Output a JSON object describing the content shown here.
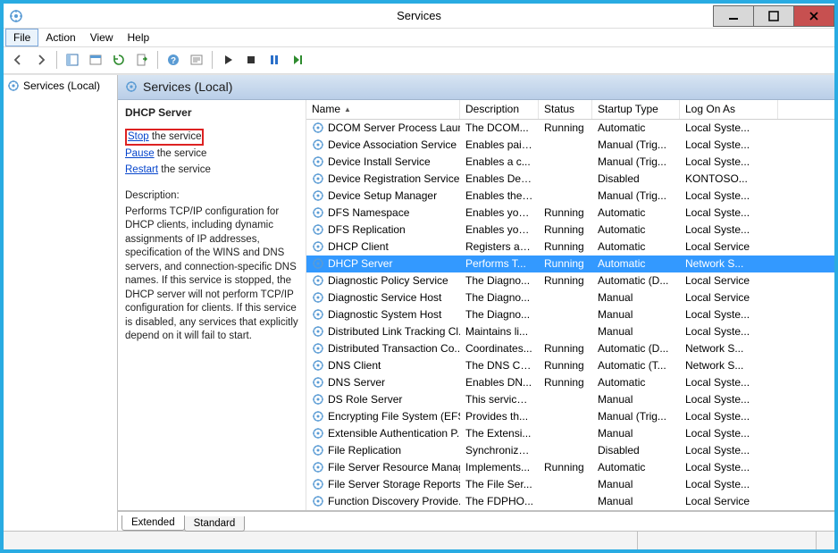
{
  "window": {
    "title": "Services",
    "menus": [
      "File",
      "Action",
      "View",
      "Help"
    ]
  },
  "tree": {
    "root": "Services (Local)"
  },
  "header": {
    "title": "Services (Local)"
  },
  "detail": {
    "service_name": "DHCP Server",
    "links": {
      "stop": "Stop",
      "stop_suffix": " the service",
      "pause": "Pause",
      "pause_suffix": " the service",
      "restart": "Restart",
      "restart_suffix": " the service"
    },
    "desc_heading": "Description:",
    "description": "Performs TCP/IP configuration for DHCP clients, including dynamic assignments of IP addresses, specification of the WINS and DNS servers, and connection-specific DNS names. If this service is stopped, the DHCP server will not perform TCP/IP configuration for clients. If this service is disabled, any services that explicitly depend on it will fail to start."
  },
  "columns": {
    "name": "Name",
    "description": "Description",
    "status": "Status",
    "startup": "Startup Type",
    "logon": "Log On As"
  },
  "tabs": {
    "extended": "Extended",
    "standard": "Standard"
  },
  "services": [
    {
      "name": "DCOM Server Process Laun...",
      "desc": "The DCOM...",
      "status": "Running",
      "start": "Automatic",
      "log": "Local Syste..."
    },
    {
      "name": "Device Association Service",
      "desc": "Enables pair...",
      "status": "",
      "start": "Manual (Trig...",
      "log": "Local Syste..."
    },
    {
      "name": "Device Install Service",
      "desc": "Enables a c...",
      "status": "",
      "start": "Manual (Trig...",
      "log": "Local Syste..."
    },
    {
      "name": "Device Registration Service",
      "desc": "Enables Dev...",
      "status": "",
      "start": "Disabled",
      "log": "KONTOSO..."
    },
    {
      "name": "Device Setup Manager",
      "desc": "Enables the ...",
      "status": "",
      "start": "Manual (Trig...",
      "log": "Local Syste..."
    },
    {
      "name": "DFS Namespace",
      "desc": "Enables you...",
      "status": "Running",
      "start": "Automatic",
      "log": "Local Syste..."
    },
    {
      "name": "DFS Replication",
      "desc": "Enables you...",
      "status": "Running",
      "start": "Automatic",
      "log": "Local Syste..."
    },
    {
      "name": "DHCP Client",
      "desc": "Registers an...",
      "status": "Running",
      "start": "Automatic",
      "log": "Local Service"
    },
    {
      "name": "DHCP Server",
      "desc": "Performs T...",
      "status": "Running",
      "start": "Automatic",
      "log": "Network S...",
      "selected": true
    },
    {
      "name": "Diagnostic Policy Service",
      "desc": "The Diagno...",
      "status": "Running",
      "start": "Automatic (D...",
      "log": "Local Service"
    },
    {
      "name": "Diagnostic Service Host",
      "desc": "The Diagno...",
      "status": "",
      "start": "Manual",
      "log": "Local Service"
    },
    {
      "name": "Diagnostic System Host",
      "desc": "The Diagno...",
      "status": "",
      "start": "Manual",
      "log": "Local Syste..."
    },
    {
      "name": "Distributed Link Tracking Cl...",
      "desc": "Maintains li...",
      "status": "",
      "start": "Manual",
      "log": "Local Syste..."
    },
    {
      "name": "Distributed Transaction Co...",
      "desc": "Coordinates...",
      "status": "Running",
      "start": "Automatic (D...",
      "log": "Network S..."
    },
    {
      "name": "DNS Client",
      "desc": "The DNS Cli...",
      "status": "Running",
      "start": "Automatic (T...",
      "log": "Network S..."
    },
    {
      "name": "DNS Server",
      "desc": "Enables DN...",
      "status": "Running",
      "start": "Automatic",
      "log": "Local Syste..."
    },
    {
      "name": "DS Role Server",
      "desc": "This service ...",
      "status": "",
      "start": "Manual",
      "log": "Local Syste..."
    },
    {
      "name": "Encrypting File System (EFS)",
      "desc": "Provides th...",
      "status": "",
      "start": "Manual (Trig...",
      "log": "Local Syste..."
    },
    {
      "name": "Extensible Authentication P...",
      "desc": "The Extensi...",
      "status": "",
      "start": "Manual",
      "log": "Local Syste..."
    },
    {
      "name": "File Replication",
      "desc": "Synchronize...",
      "status": "",
      "start": "Disabled",
      "log": "Local Syste..."
    },
    {
      "name": "File Server Resource Manager",
      "desc": "Implements...",
      "status": "Running",
      "start": "Automatic",
      "log": "Local Syste..."
    },
    {
      "name": "File Server Storage Reports ...",
      "desc": "The File Ser...",
      "status": "",
      "start": "Manual",
      "log": "Local Syste..."
    },
    {
      "name": "Function Discovery Provide...",
      "desc": "The FDPHO...",
      "status": "",
      "start": "Manual",
      "log": "Local Service"
    }
  ]
}
